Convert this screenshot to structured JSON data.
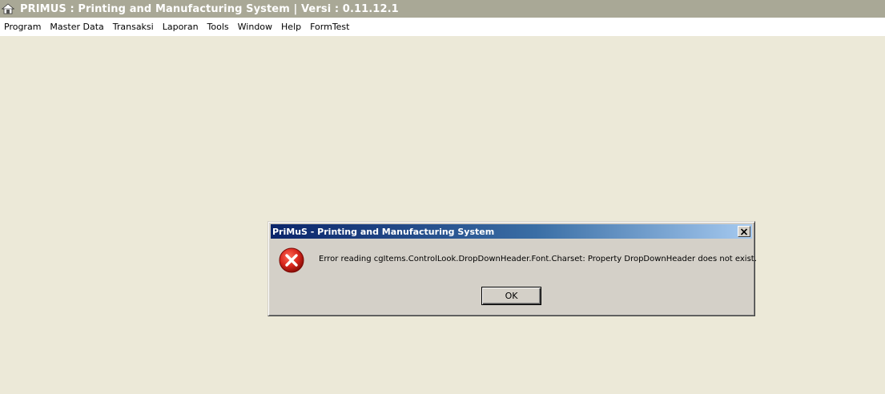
{
  "app": {
    "title": "PRIMUS : Printing and Manufacturing System | Versi : 0.11.12.1",
    "icon": "house-icon"
  },
  "menubar": {
    "items": [
      {
        "label": "Program"
      },
      {
        "label": "Master Data"
      },
      {
        "label": "Transaksi"
      },
      {
        "label": "Laporan"
      },
      {
        "label": "Tools"
      },
      {
        "label": "Window"
      },
      {
        "label": "Help"
      },
      {
        "label": "FormTest"
      }
    ]
  },
  "dialog": {
    "title": "PriMuS - Printing and Manufacturing System",
    "message": "Error reading cgItems.ControlLook.DropDownHeader.Font.Charset: Property DropDownHeader does not exist.",
    "ok_label": "OK",
    "icon": "error-icon",
    "close_icon": "close-icon"
  },
  "colors": {
    "app_titlebar": "#A9A896",
    "background": "#ECE9D8",
    "dialog_face": "#D4D0C8",
    "dialog_title_start": "#0A246A",
    "dialog_title_end": "#A6CAF0",
    "error_red": "#D8261D"
  }
}
